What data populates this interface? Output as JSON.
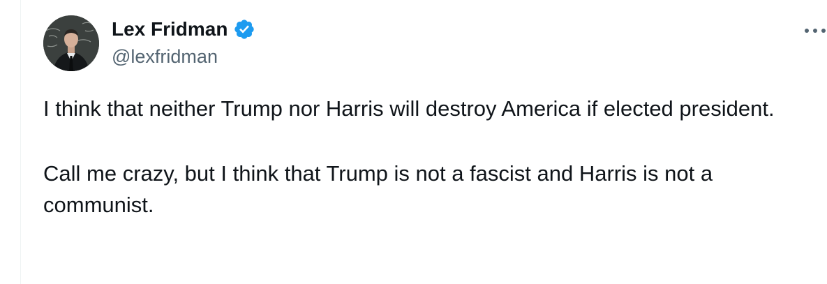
{
  "tweet": {
    "author": {
      "display_name": "Lex Fridman",
      "handle": "@lexfridman",
      "verified_icon": "verified-badge-icon",
      "accent_color": "#1d9bf0"
    },
    "more_icon": "more-options-icon",
    "paragraphs": [
      "I think that neither Trump nor Harris will destroy America if elected president.",
      "Call me crazy, but I think that Trump is not a fascist and Harris is not a communist."
    ]
  }
}
